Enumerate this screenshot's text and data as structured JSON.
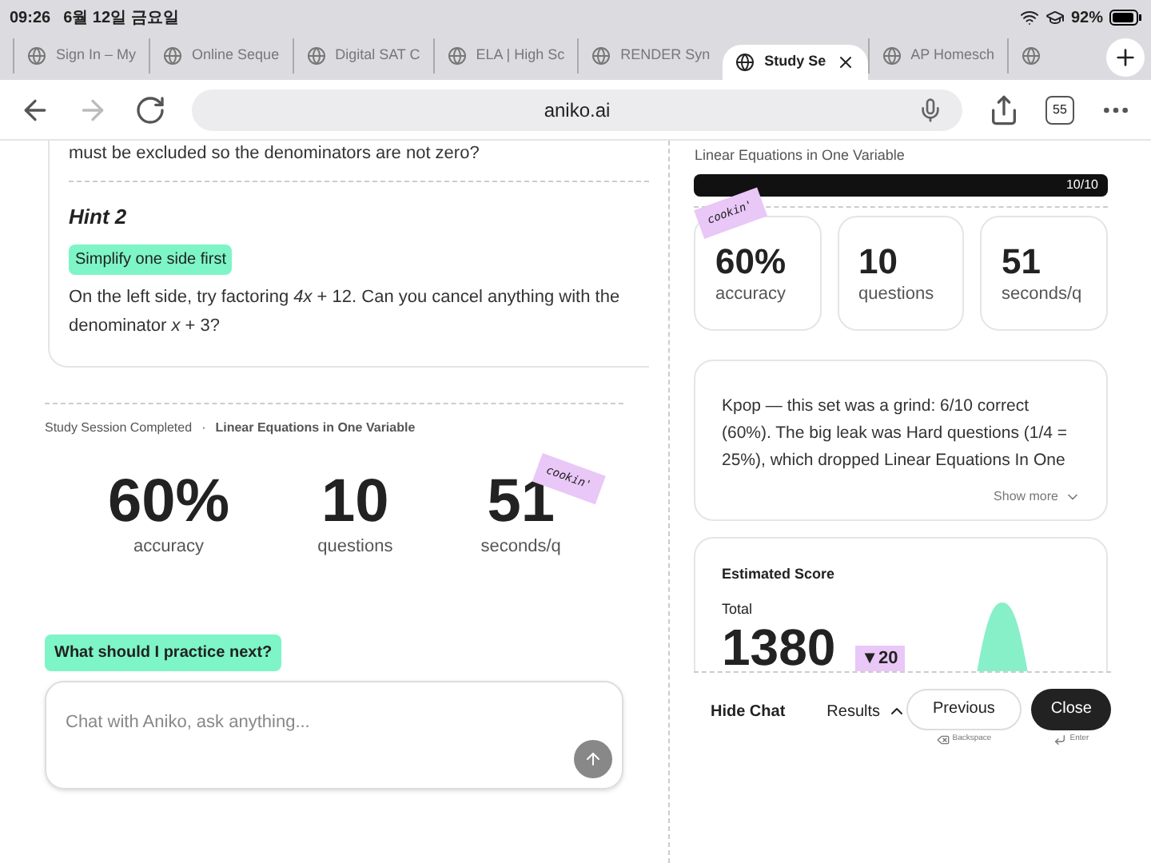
{
  "status_bar": {
    "time": "09:26",
    "date": "6월 12일 금요일",
    "battery": "92%"
  },
  "tabs": [
    {
      "label": "Sign In – My",
      "selected": false
    },
    {
      "label": "Online Seque",
      "selected": false
    },
    {
      "label": "Digital SAT C",
      "selected": false
    },
    {
      "label": "ELA | High Sc",
      "selected": false
    },
    {
      "label": "RENDER Syn",
      "selected": false
    },
    {
      "label": "Study Se",
      "selected": true
    },
    {
      "label": "AP Homesch",
      "selected": false
    },
    {
      "selected": false
    }
  ],
  "toolbar": {
    "url": "aniko.ai",
    "tab_count": "55"
  },
  "hint_section": {
    "previous_text": "must be excluded so the denominators are not zero?",
    "title": "Hint 2",
    "tag": "Simplify one side first",
    "body": "On the left side, try factoring *4x* + 12. Can you cancel anything with the denominator *x* + 3?"
  },
  "session": {
    "label": "Study Session Completed",
    "separator": "·",
    "topic": "Linear Equations in One Variable",
    "stats": [
      {
        "value": "60%",
        "label": "accuracy"
      },
      {
        "value": "10",
        "label": "questions"
      },
      {
        "value": "51",
        "label": "seconds/q"
      }
    ],
    "sticker": "cookin'"
  },
  "chat": {
    "suggestion": "What should I practice next?",
    "placeholder": "Chat with Aniko, ask anything..."
  },
  "results": {
    "topic": "Linear Equations in One Variable",
    "progress": {
      "level": 1,
      "reading": "10/10"
    },
    "sticker": "cookin'",
    "stats": [
      {
        "value": "60%",
        "label": "accuracy"
      },
      {
        "value": "10",
        "label": "questions"
      },
      {
        "value": "51",
        "label": "seconds/q"
      }
    ],
    "summary": {
      "text": "Kpop — this set was a grind: 6/10 correct (60%). The big leak was Hard questions (1/4 = 25%), which dropped Linear Equations In One",
      "toggle": "Show more"
    },
    "score": {
      "title": "Estimated Score",
      "label": "Total",
      "value": "1380",
      "change": "▼20"
    }
  },
  "footer": {
    "hide_chat": "Hide Chat",
    "results": "Results",
    "previous": "Previous",
    "previous_key": "Backspace",
    "close": "Close",
    "close_key": "Enter"
  }
}
